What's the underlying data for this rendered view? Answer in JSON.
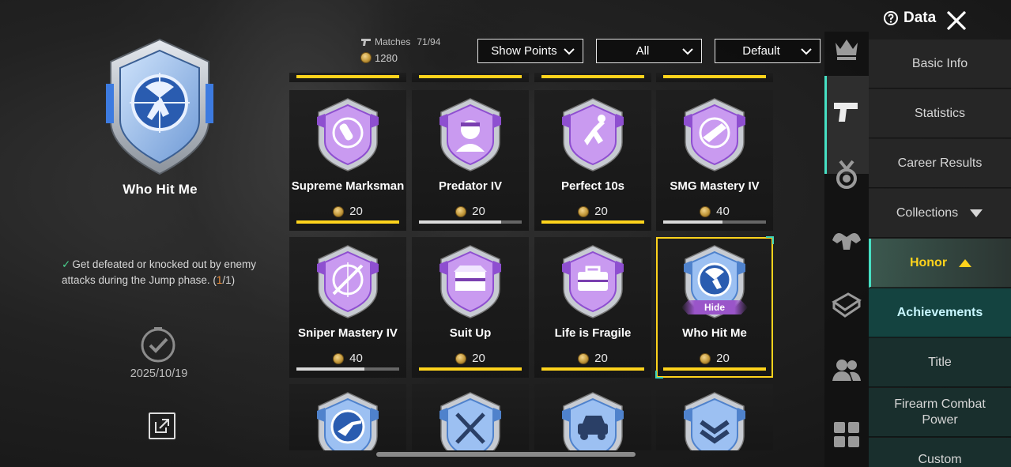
{
  "header": {
    "data_label": "Data",
    "matches_label": "Matches",
    "matches_value": "71/94",
    "points_total": "1280"
  },
  "filters": {
    "show": "Show Points",
    "category": "All",
    "sort": "Default"
  },
  "selected": {
    "title": "Who Hit Me",
    "description": "Get defeated or knocked out by enemy attacks during the Jump phase.",
    "progress_open": "(",
    "progress_current": "1",
    "progress_rest": "/1)",
    "date": "2025/10/19"
  },
  "cards": [
    {
      "name": "Supreme Marksman",
      "points": "20",
      "progress": 1.0,
      "color": "purple",
      "icon": "bullet-crosshair-icon"
    },
    {
      "name": "Predator IV",
      "points": "20",
      "progress": 0.8,
      "color": "purple",
      "icon": "soldier-head-icon"
    },
    {
      "name": "Perfect 10s",
      "points": "20",
      "progress": 1.0,
      "color": "purple",
      "icon": "parachute-diver-icon"
    },
    {
      "name": "SMG Mastery IV",
      "points": "40",
      "progress": 0.58,
      "color": "purple",
      "icon": "smg-crosshair-icon"
    },
    {
      "name": "Sniper Mastery IV",
      "points": "40",
      "progress": 0.66,
      "color": "purple",
      "icon": "sniper-crosshair-icon"
    },
    {
      "name": "Suit Up",
      "points": "20",
      "progress": 1.0,
      "color": "purple",
      "icon": "supply-crate-icon"
    },
    {
      "name": "Life is Fragile",
      "points": "20",
      "progress": 1.0,
      "color": "purple",
      "icon": "medkit-case-icon"
    },
    {
      "name": "Who Hit Me",
      "points": "20",
      "progress": 1.0,
      "color": "blue",
      "icon": "parachute-target-icon",
      "hide_label": "Hide"
    }
  ],
  "menu": {
    "basic_info": "Basic Info",
    "statistics": "Statistics",
    "career_results": "Career Results",
    "collections": "Collections",
    "honor": "Honor",
    "achievements": "Achievements",
    "title": "Title",
    "firearm_line1": "Firearm Combat",
    "firearm_line2": "Power",
    "custom": "Custom"
  },
  "colors": {
    "accent_yellow": "#ffd31c",
    "accent_teal": "#46e0c4",
    "purple_badge": "#b77ee6",
    "blue_badge": "#5a8fd6",
    "progress_orange": "#f0913c"
  }
}
